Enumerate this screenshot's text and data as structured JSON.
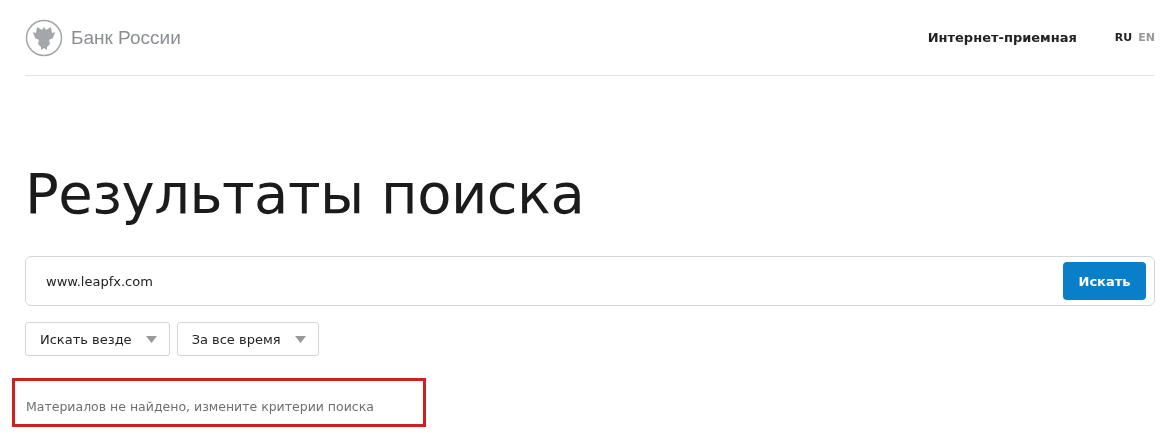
{
  "header": {
    "logo_text": "Банк России",
    "nav_link": "Интернет-приемная",
    "languages": [
      {
        "label": "RU",
        "selected": true
      },
      {
        "label": "EN",
        "selected": false
      }
    ]
  },
  "title": "Результаты поиска",
  "search": {
    "value": "www.leapfx.com",
    "button": "Искать"
  },
  "filters": [
    {
      "label": "Искать везде"
    },
    {
      "label": "За все время"
    }
  ],
  "message": "Материалов не найдено, измените критерии поиска"
}
